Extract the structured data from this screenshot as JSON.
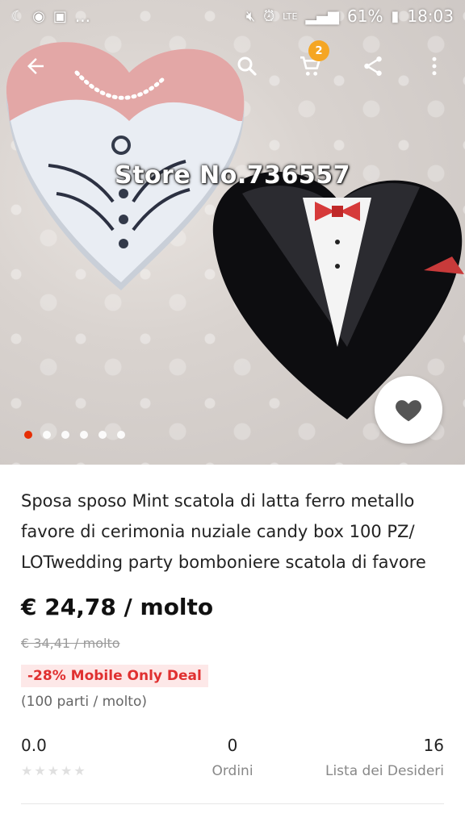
{
  "status_bar": {
    "battery": "61%",
    "time": "18:03",
    "network": "LTE",
    "dots": "..."
  },
  "toolbar": {
    "cart_count": "2"
  },
  "hero": {
    "watermark": "Store No.736557",
    "dots_total": 6,
    "active_dot": 0
  },
  "product": {
    "title": "Sposa sposo Mint scatola di latta ferro metallo favore di cerimonia nuziale candy box 100 PZ/ LOTwedding party bomboniere scatola di favore",
    "price": "€ 24,78 / molto",
    "original_price": "€ 34,41 / molto",
    "deal": "-28% Mobile Only Deal",
    "lot_note": "(100 parti / molto)"
  },
  "stats": {
    "rating": "0.0",
    "orders_count": "0",
    "orders_label": "Ordini",
    "wishlist_count": "16",
    "wishlist_label": "Lista dei Desideri"
  },
  "colors": {
    "accent": "#e62e04",
    "badge": "#f5a623",
    "deal_text": "#e03030"
  }
}
